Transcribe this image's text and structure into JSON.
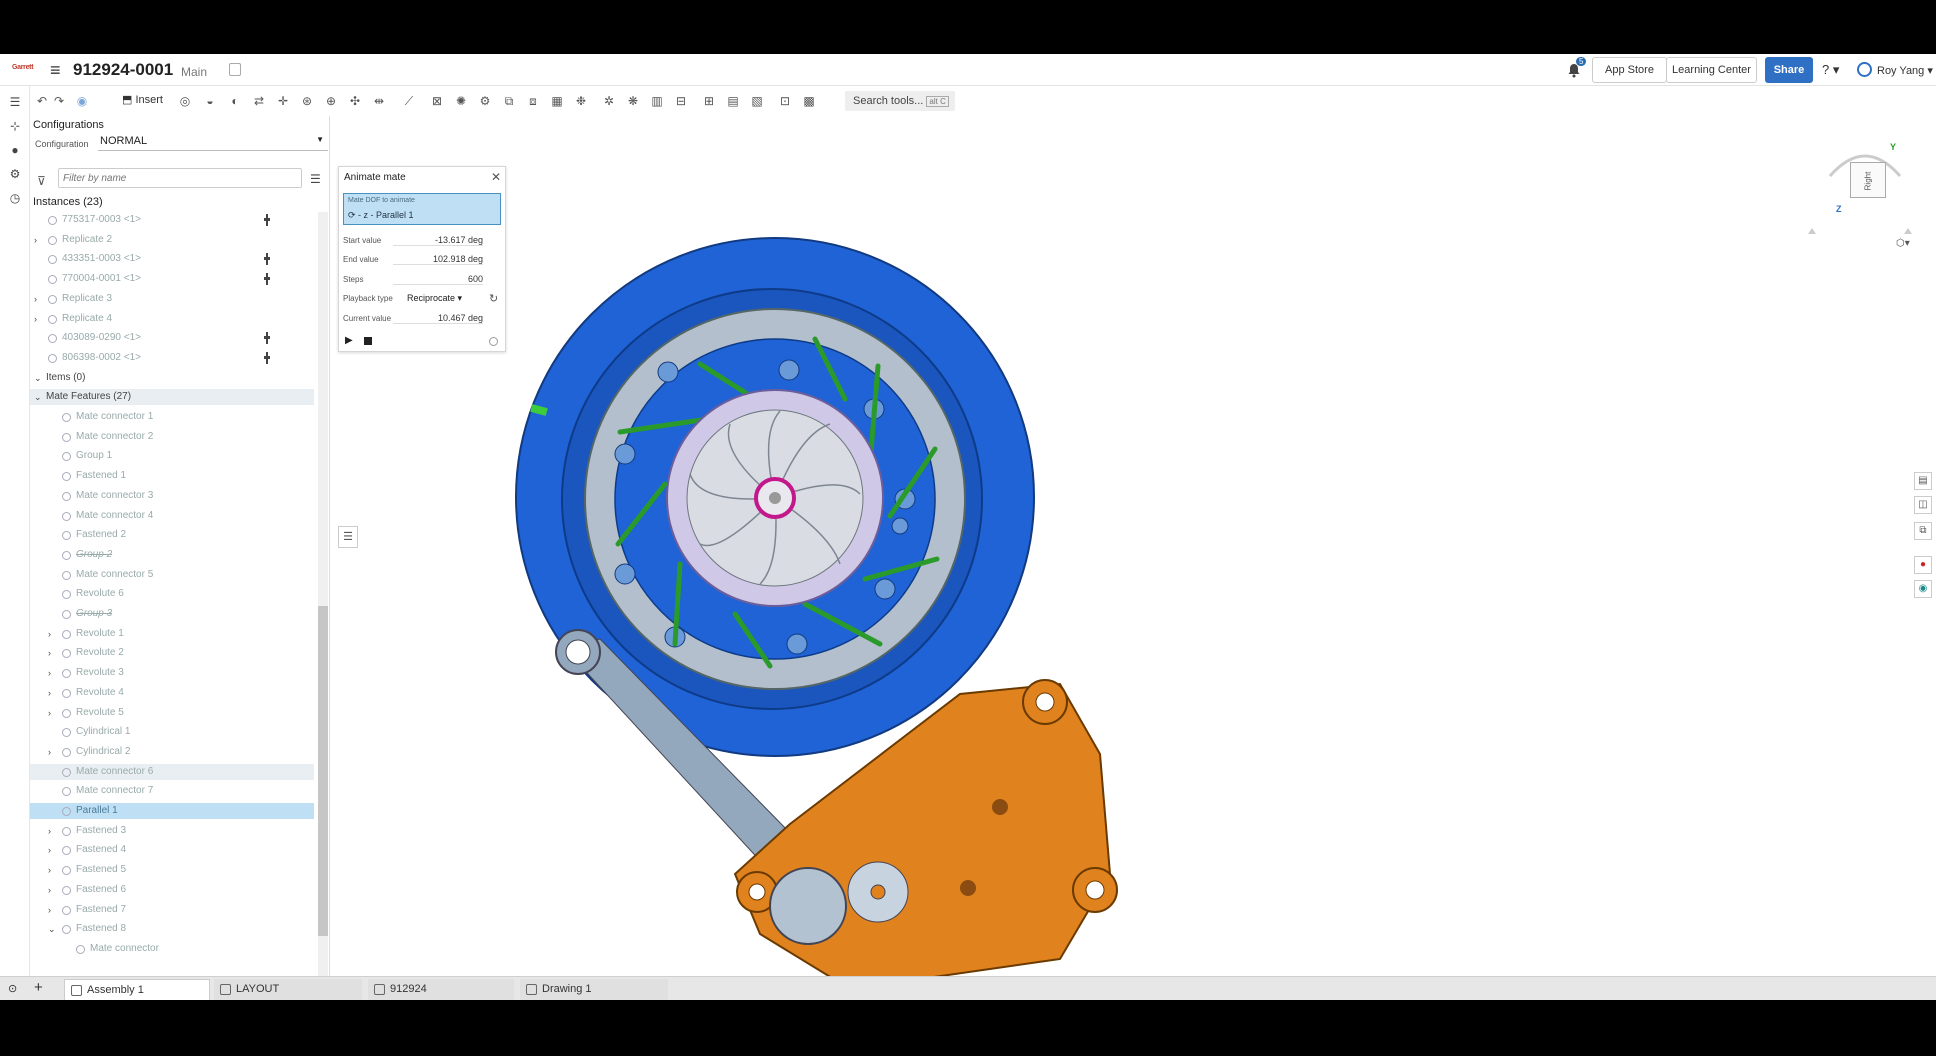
{
  "app": {
    "logo_text": "Garrett",
    "doc_title": "912924-0001",
    "branch": "Main",
    "notification_count": "5",
    "app_store": "App Store",
    "learning_center": "Learning Center",
    "share": "Share",
    "help": "?",
    "user": "Roy Yang"
  },
  "toolbar": {
    "insert": "Insert",
    "search_tools": "Search tools...",
    "search_shortcut": "alt C",
    "icons": [
      "undo-icon",
      "redo-icon",
      "view-icon",
      "insert-icon",
      "mate-connector-icon",
      "fastened-mate-icon",
      "revolute-mate-icon",
      "slider-mate-icon",
      "planar-mate-icon",
      "cylindrical-mate-icon",
      "pin-slot-mate-icon",
      "ball-mate-icon",
      "parallel-mate-icon",
      "tangent-mate-icon",
      "group-icon",
      "gear-relation-icon",
      "rack-pinion-icon",
      "screw-relation-icon",
      "linear-relation-icon",
      "replicate-icon",
      "pattern-icon",
      "explode-icon",
      "section-icon",
      "measure-icon",
      "mass-properties-icon",
      "bom-icon"
    ]
  },
  "configurations": {
    "title": "Configurations",
    "label": "Configuration",
    "value": "NORMAL"
  },
  "filter": {
    "placeholder": "Filter by name"
  },
  "instances": {
    "heading": "Instances (23)",
    "rows": [
      {
        "label": "775317-0003 <1>",
        "level": 1,
        "chev": "",
        "pin": true,
        "style": ""
      },
      {
        "label": "Replicate 2",
        "level": 1,
        "chev": "›",
        "pin": false,
        "style": ""
      },
      {
        "label": "433351-0003 <1>",
        "level": 1,
        "chev": "",
        "pin": true,
        "style": ""
      },
      {
        "label": "770004-0001 <1>",
        "level": 1,
        "chev": "",
        "pin": true,
        "style": ""
      },
      {
        "label": "Replicate 3",
        "level": 1,
        "chev": "›",
        "pin": false,
        "style": ""
      },
      {
        "label": "Replicate 4",
        "level": 1,
        "chev": "›",
        "pin": false,
        "style": ""
      },
      {
        "label": "403089-0290 <1>",
        "level": 1,
        "chev": "",
        "pin": true,
        "style": ""
      },
      {
        "label": "806398-0002 <1>",
        "level": 1,
        "chev": "",
        "pin": true,
        "style": ""
      },
      {
        "label": "Items (0)",
        "level": 0,
        "chev": "⌄",
        "pin": false,
        "style": "hdr"
      },
      {
        "label": "Mate Features (27)",
        "level": 0,
        "chev": "⌄",
        "pin": false,
        "style": "hdr hl"
      },
      {
        "label": "Mate connector 1",
        "level": 2,
        "chev": "",
        "pin": false,
        "style": ""
      },
      {
        "label": "Mate connector 2",
        "level": 2,
        "chev": "",
        "pin": false,
        "style": ""
      },
      {
        "label": "Group 1",
        "level": 2,
        "chev": "",
        "pin": false,
        "style": ""
      },
      {
        "label": "Fastened 1",
        "level": 2,
        "chev": "",
        "pin": false,
        "style": ""
      },
      {
        "label": "Mate connector 3",
        "level": 2,
        "chev": "",
        "pin": false,
        "style": ""
      },
      {
        "label": "Mate connector 4",
        "level": 2,
        "chev": "",
        "pin": false,
        "style": ""
      },
      {
        "label": "Fastened 2",
        "level": 2,
        "chev": "",
        "pin": false,
        "style": ""
      },
      {
        "label": "Group 2",
        "level": 2,
        "chev": "",
        "pin": false,
        "style": "strike"
      },
      {
        "label": "Mate connector 5",
        "level": 2,
        "chev": "",
        "pin": false,
        "style": ""
      },
      {
        "label": "Revolute 6",
        "level": 2,
        "chev": "",
        "pin": false,
        "style": ""
      },
      {
        "label": "Group 3",
        "level": 2,
        "chev": "",
        "pin": false,
        "style": "strike"
      },
      {
        "label": "Revolute 1",
        "level": 2,
        "chev": "›",
        "pin": false,
        "style": ""
      },
      {
        "label": "Revolute 2",
        "level": 2,
        "chev": "›",
        "pin": false,
        "style": ""
      },
      {
        "label": "Revolute 3",
        "level": 2,
        "chev": "›",
        "pin": false,
        "style": ""
      },
      {
        "label": "Revolute 4",
        "level": 2,
        "chev": "›",
        "pin": false,
        "style": ""
      },
      {
        "label": "Revolute 5",
        "level": 2,
        "chev": "›",
        "pin": false,
        "style": ""
      },
      {
        "label": "Cylindrical 1",
        "level": 2,
        "chev": "",
        "pin": false,
        "style": ""
      },
      {
        "label": "Cylindrical 2",
        "level": 2,
        "chev": "›",
        "pin": false,
        "style": ""
      },
      {
        "label": "Mate connector 6",
        "level": 2,
        "chev": "",
        "pin": false,
        "style": "hl"
      },
      {
        "label": "Mate connector 7",
        "level": 2,
        "chev": "",
        "pin": false,
        "style": ""
      },
      {
        "label": "Parallel 1",
        "level": 2,
        "chev": "",
        "pin": false,
        "style": "sel"
      },
      {
        "label": "Fastened 3",
        "level": 2,
        "chev": "›",
        "pin": false,
        "style": ""
      },
      {
        "label": "Fastened 4",
        "level": 2,
        "chev": "›",
        "pin": false,
        "style": ""
      },
      {
        "label": "Fastened 5",
        "level": 2,
        "chev": "›",
        "pin": false,
        "style": ""
      },
      {
        "label": "Fastened 6",
        "level": 2,
        "chev": "›",
        "pin": false,
        "style": ""
      },
      {
        "label": "Fastened 7",
        "level": 2,
        "chev": "›",
        "pin": false,
        "style": ""
      },
      {
        "label": "Fastened 8",
        "level": 2,
        "chev": "⌄",
        "pin": false,
        "style": ""
      },
      {
        "label": "Mate connector",
        "level": 3,
        "chev": "",
        "pin": false,
        "style": ""
      }
    ]
  },
  "animate_mate": {
    "title": "Animate mate",
    "mdof_label": "Mate DOF to animate",
    "mdof_value": "⟳ - z - Parallel 1",
    "start_label": "Start value",
    "start_value": "-13.617 deg",
    "end_label": "End value",
    "end_value": "102.918 deg",
    "steps_label": "Steps",
    "steps_value": "600",
    "playback_label": "Playback type",
    "playback_value": "Reciprocate",
    "current_label": "Current value",
    "current_value": "10.467 deg"
  },
  "viewcube": {
    "face": "Right",
    "y": "Y",
    "z": "Z"
  },
  "tabs": [
    {
      "label": "Assembly 1",
      "active": true
    },
    {
      "label": "LAYOUT",
      "active": false
    },
    {
      "label": "912924",
      "active": false
    },
    {
      "label": "Drawing 1",
      "active": false
    }
  ],
  "colors": {
    "housing_blue": "#1f63d6",
    "ring_grey": "#b3bfcc",
    "actuator_orange": "#e0821e",
    "vane_green": "#2a9a2a",
    "selection_blue": "#bfe0f4",
    "share_blue": "#2f6fc4"
  }
}
